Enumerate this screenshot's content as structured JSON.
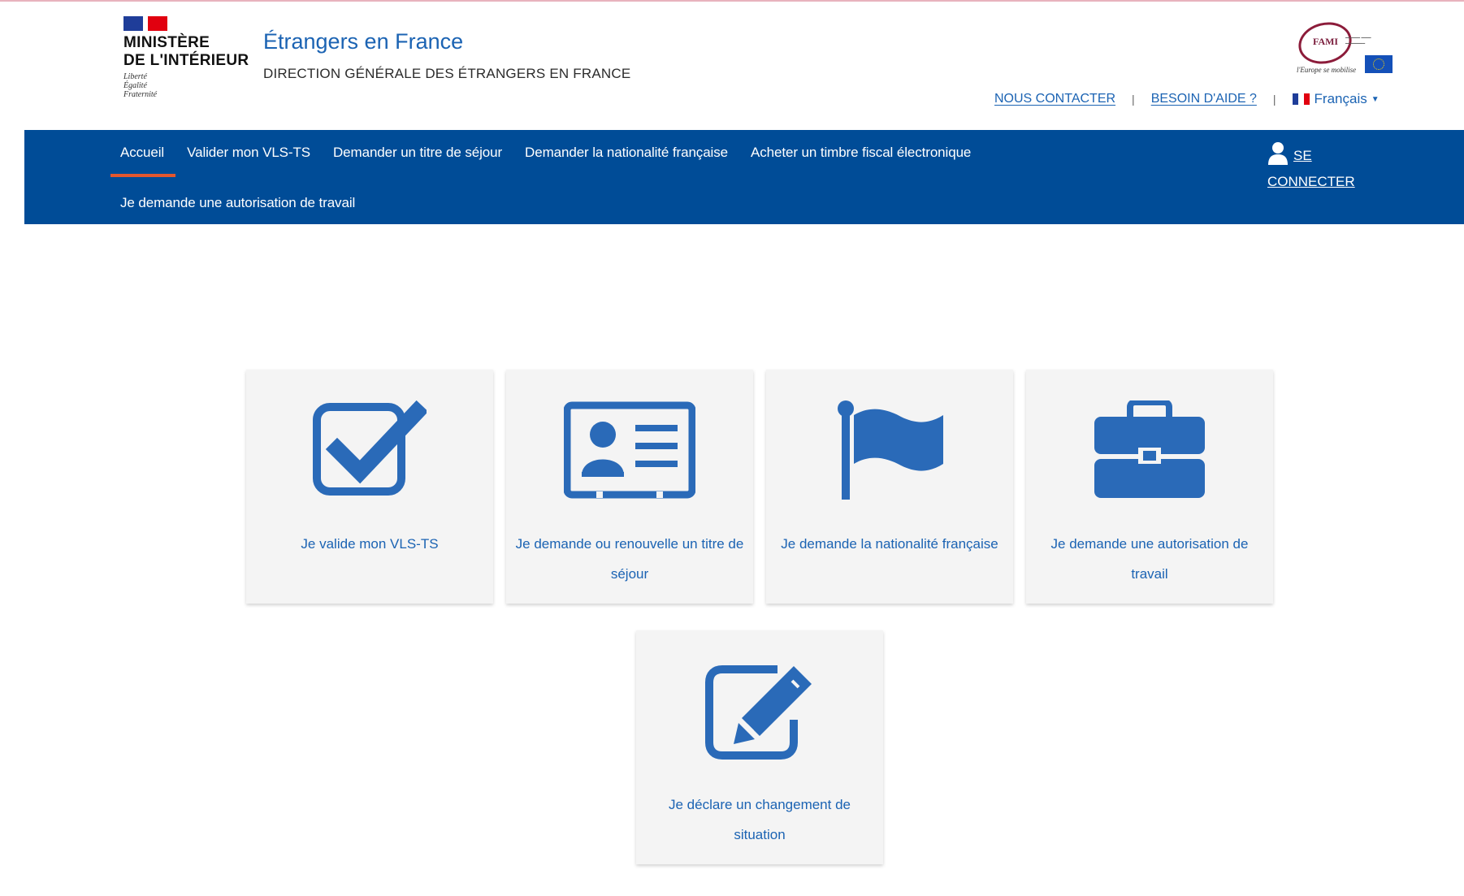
{
  "header": {
    "ministry_name": "MINISTÈRE\nDE L'INTÉRIEUR",
    "motto": "Liberté\nÉgalité\nFraternité",
    "site_title": "Étrangers en France",
    "site_subtitle": "DIRECTION GÉNÉRALE DES ÉTRANGERS EN FRANCE",
    "partner_logo_text": "FAMI",
    "partner_logo_tagline": "l'Europe se mobilise",
    "util_links": {
      "contact": "NOUS CONTACTER",
      "help": "BESOIN D'AIDE ?",
      "language": "Français"
    }
  },
  "nav": {
    "items": [
      {
        "label": "Accueil",
        "active": true
      },
      {
        "label": "Valider mon VLS-TS"
      },
      {
        "label": "Demander un titre de séjour"
      },
      {
        "label": "Demander la nationalité française"
      },
      {
        "label": "Acheter un timbre fiscal électronique"
      },
      {
        "label": "Je demande une autorisation de travail"
      }
    ],
    "login_line1": "SE",
    "login_line2": "CONNECTER"
  },
  "tiles": [
    {
      "icon": "checkbox-icon",
      "label": "Je valide mon VLS-TS"
    },
    {
      "icon": "id-card-icon",
      "label": "Je demande ou renouvelle un titre de séjour"
    },
    {
      "icon": "flag-icon",
      "label": "Je demande la nationalité française"
    },
    {
      "icon": "briefcase-icon",
      "label": "Je demande une autorisation de travail"
    },
    {
      "icon": "edit-icon",
      "label": "Je déclare un changement de situation"
    }
  ],
  "colors": {
    "nav_background": "#004c97",
    "active_underline": "#e4572e",
    "link_blue": "#1b63b3",
    "tile_background": "#f4f4f4",
    "icon_blue": "#2a6ab8"
  }
}
